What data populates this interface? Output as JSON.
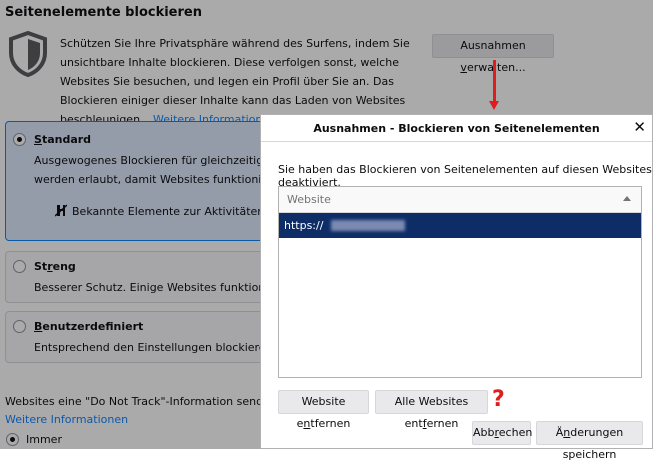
{
  "settings": {
    "section_title": "Seitenelemente blockieren",
    "intro_text": "Schützen Sie Ihre Privatsphäre während des Surfens, indem Sie unsichtbare Inhalte blockieren. Diese verfolgen sonst, welche Websites Sie besuchen, und legen ein Profil über Sie an. Das Blockieren einiger dieser Inhalte kann das Laden von Websites beschleunigen.",
    "learn_more": "Weitere Informationen",
    "manage_exceptions_pre": "Ausnahmen ",
    "manage_exceptions_key": "v",
    "manage_exceptions_post": "erwalten...",
    "options": [
      {
        "title_key": "S",
        "title_rest": "tandard",
        "desc1": "Ausgewogenes Blockieren für gleichzeitigen Schutz",
        "desc2": "werden erlaubt, damit Websites funktionieren.",
        "feature": "Bekannte Elemente zur Aktivitätenverfolgung",
        "checked": true
      },
      {
        "title_pre": "St",
        "title_key": "r",
        "title_rest": "eng",
        "desc1": "Besserer Schutz. Einige Websites funktionieren ev",
        "checked": false
      },
      {
        "title_key": "B",
        "title_rest": "enutzerdefiniert",
        "desc1": "Entsprechend den Einstellungen blockieren:",
        "checked": false
      }
    ],
    "dnt_text": "Websites eine \"Do Not Track\"-Information senden, dass",
    "dnt_learn_more": "Weitere Informationen",
    "dnt_always": "Immer"
  },
  "dialog": {
    "title": "Ausnahmen - Blockieren von Seitenelementen",
    "close_glyph": "✕",
    "description": "Sie haben das Blockieren von Seitenelementen auf diesen Websites deaktiviert.",
    "column_header": "Website",
    "rows": [
      {
        "site": "https://"
      }
    ],
    "remove_site_pre": "Website e",
    "remove_site_key": "n",
    "remove_site_post": "tfernen",
    "remove_all_pre": "Alle Websites ent",
    "remove_all_key": "f",
    "remove_all_post": "ernen",
    "cancel_pre": "Abb",
    "cancel_key": "r",
    "cancel_post": "echen",
    "save_pre": "Ä",
    "save_key": "n",
    "save_post": "derungen speichern"
  },
  "annotations": {
    "question_mark": "?",
    "arrow_color": "#e01d1d"
  }
}
